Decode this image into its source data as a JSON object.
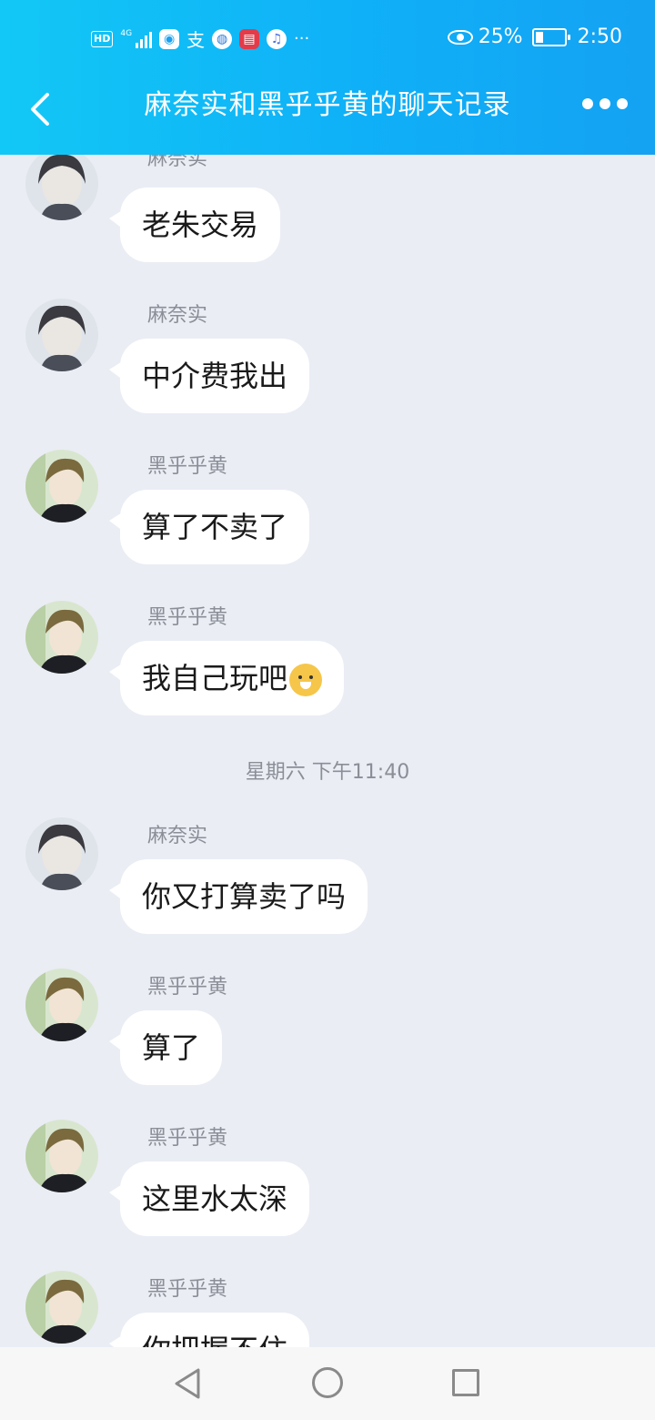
{
  "status_bar": {
    "network_badge": "HD",
    "network_type": "4G",
    "alipay_glyph": "支",
    "more_glyph": "···",
    "battery_percent": "25%",
    "battery_level": 0.25,
    "time": "2:50"
  },
  "header": {
    "title": "麻奈实和黑乎乎黄的聊天记录",
    "background_color": "#0fb0f7"
  },
  "messages": [
    {
      "sender": "麻奈实",
      "text": "老朱交易",
      "avatar": "avatar-manami"
    },
    {
      "sender": "麻奈实",
      "text": "中介费我出",
      "avatar": "avatar-manami"
    },
    {
      "sender": "黑乎乎黄",
      "text": "算了不卖了",
      "avatar": "avatar-huang"
    },
    {
      "sender": "黑乎乎黄",
      "text": "我自己玩吧",
      "avatar": "avatar-huang",
      "emoji": "shiba-emoji"
    },
    {
      "sender": "麻奈实",
      "text": "你又打算卖了吗",
      "avatar": "avatar-manami"
    },
    {
      "sender": "黑乎乎黄",
      "text": "算了",
      "avatar": "avatar-huang"
    },
    {
      "sender": "黑乎乎黄",
      "text": "这里水太深",
      "avatar": "avatar-huang"
    },
    {
      "sender": "黑乎乎黄",
      "text": "你把握不住",
      "avatar": "avatar-huang"
    }
  ],
  "timestamp": "星期六 下午11:40",
  "icons": [
    "back-icon",
    "more-icon",
    "eye-icon",
    "battery-icon",
    "nav-back-icon",
    "nav-home-icon",
    "nav-recent-icon"
  ]
}
